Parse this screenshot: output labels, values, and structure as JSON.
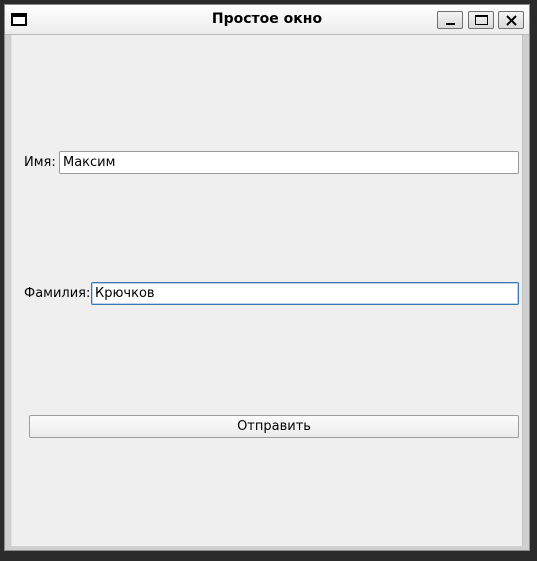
{
  "window": {
    "title": "Простое окно"
  },
  "form": {
    "first_name_label": "Имя:",
    "first_name_value": "Максим",
    "last_name_label": "Фамилия:",
    "last_name_value": "Крючков",
    "submit_label": "Отправить"
  },
  "icons": {
    "app": "window-icon",
    "minimize": "minimize-icon",
    "maximize": "maximize-icon",
    "close": "close-icon"
  },
  "colors": {
    "background": "#efefef",
    "focus_border": "#3a78b5"
  }
}
